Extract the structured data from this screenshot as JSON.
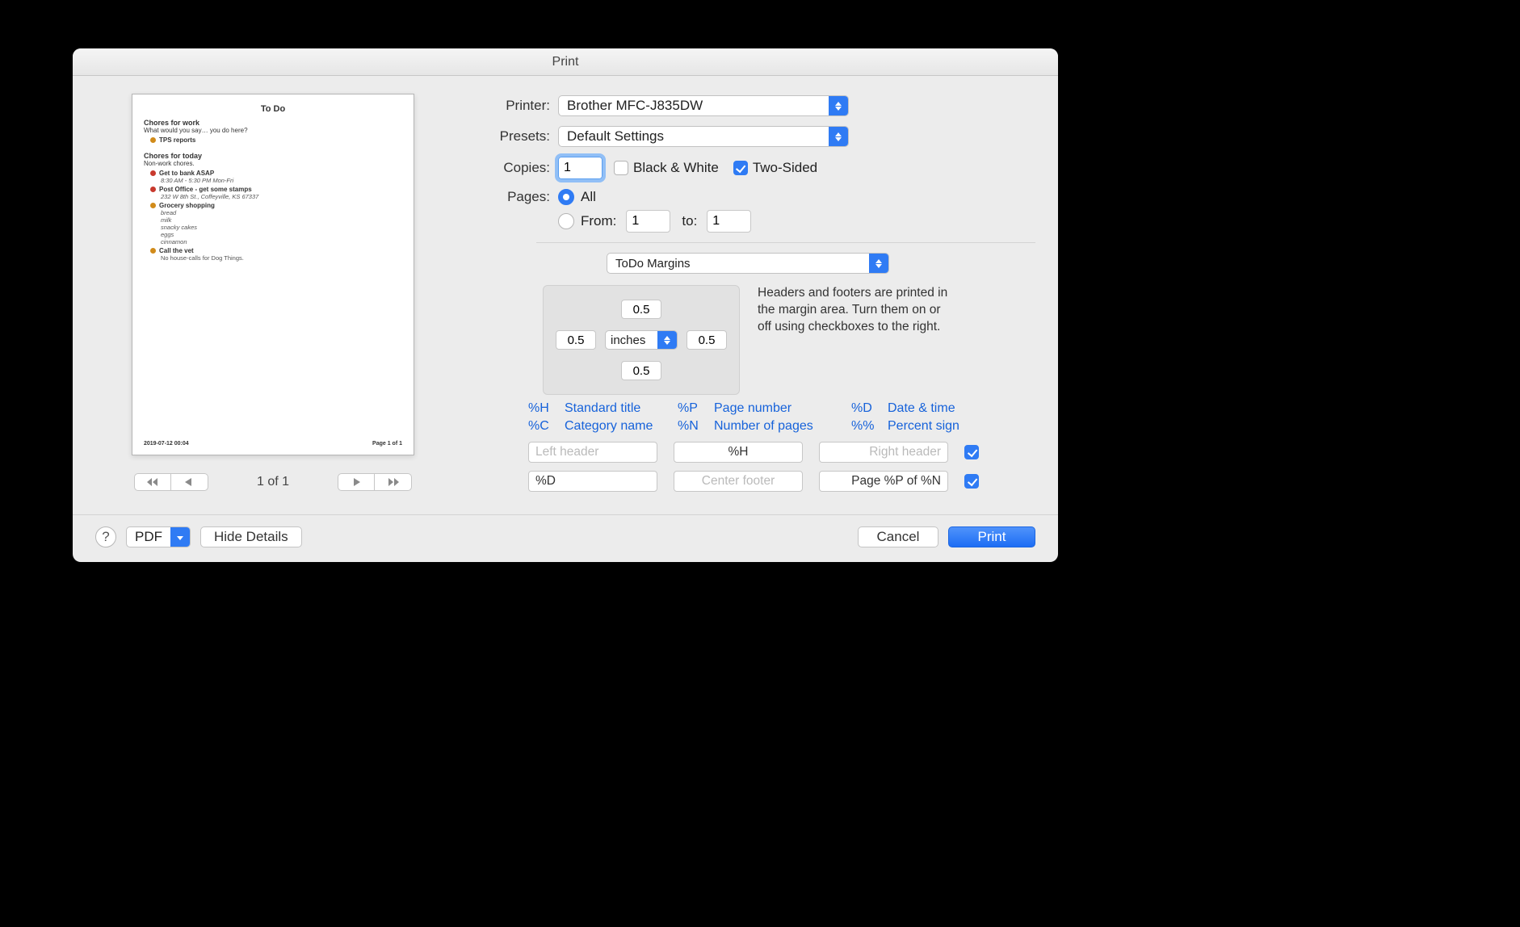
{
  "window": {
    "title": "Print"
  },
  "labels": {
    "printer": "Printer:",
    "presets": "Presets:",
    "copies": "Copies:",
    "pages": "Pages:",
    "bw": "Black & White",
    "twosided": "Two-Sided",
    "all": "All",
    "from": "From:",
    "to": "to:"
  },
  "printer": {
    "value": "Brother MFC-J835DW"
  },
  "presets": {
    "value": "Default Settings"
  },
  "copies": {
    "value": "1",
    "bw_checked": false,
    "twosided_checked": true
  },
  "pages": {
    "mode": "all",
    "from": "1",
    "to": "1"
  },
  "panel_select": {
    "value": "ToDo Margins"
  },
  "margins": {
    "top": "0.5",
    "left": "0.5",
    "right": "0.5",
    "bottom": "0.5",
    "units": "inches"
  },
  "margins_help": "Headers and footers are printed in the margin area. Turn them on or off using checkboxes to the right.",
  "tokens": {
    "h": "%H",
    "h_label": "Standard title",
    "p": "%P",
    "p_label": "Page number",
    "d": "%D",
    "d_label": "Date & time",
    "c": "%C",
    "c_label": "Category name",
    "n": "%N",
    "n_label": "Number of pages",
    "pct": "%%",
    "pct_label": "Percent sign"
  },
  "header": {
    "left_placeholder": "Left header",
    "center_value": "%H",
    "right_placeholder": "Right header",
    "checked": true
  },
  "footer": {
    "left_value": "%D",
    "center_placeholder": "Center footer",
    "right_value": "Page %P of %N",
    "checked": true
  },
  "pager": {
    "text": "1 of 1"
  },
  "bottom": {
    "pdf": "PDF",
    "hide": "Hide Details",
    "cancel": "Cancel",
    "print": "Print",
    "help": "?"
  },
  "preview": {
    "title": "To Do",
    "cat1": "Chores for work",
    "cat1_desc": "What would you say… you do here?",
    "c1_items": [
      {
        "t": "TPS reports"
      }
    ],
    "cat2": "Chores for today",
    "cat2_desc": "Non-work chores.",
    "c2_items": [
      {
        "t": "Get to bank ASAP",
        "sub": "8:30 AM - 5:30 PM Mon-Fri",
        "red": true
      },
      {
        "t": "Post Office - get some stamps",
        "sub": "232 W 8th St., Coffeyville, KS 67337",
        "red": true
      },
      {
        "t": "Grocery shopping",
        "list": [
          "bread",
          "milk",
          "snacky cakes",
          "eggs",
          "cinnamon"
        ]
      },
      {
        "t": "Call the vet",
        "sub": "No house-calls for Dog Things."
      }
    ],
    "foot_left": "2019-07-12 00:04",
    "foot_right": "Page 1 of 1"
  }
}
